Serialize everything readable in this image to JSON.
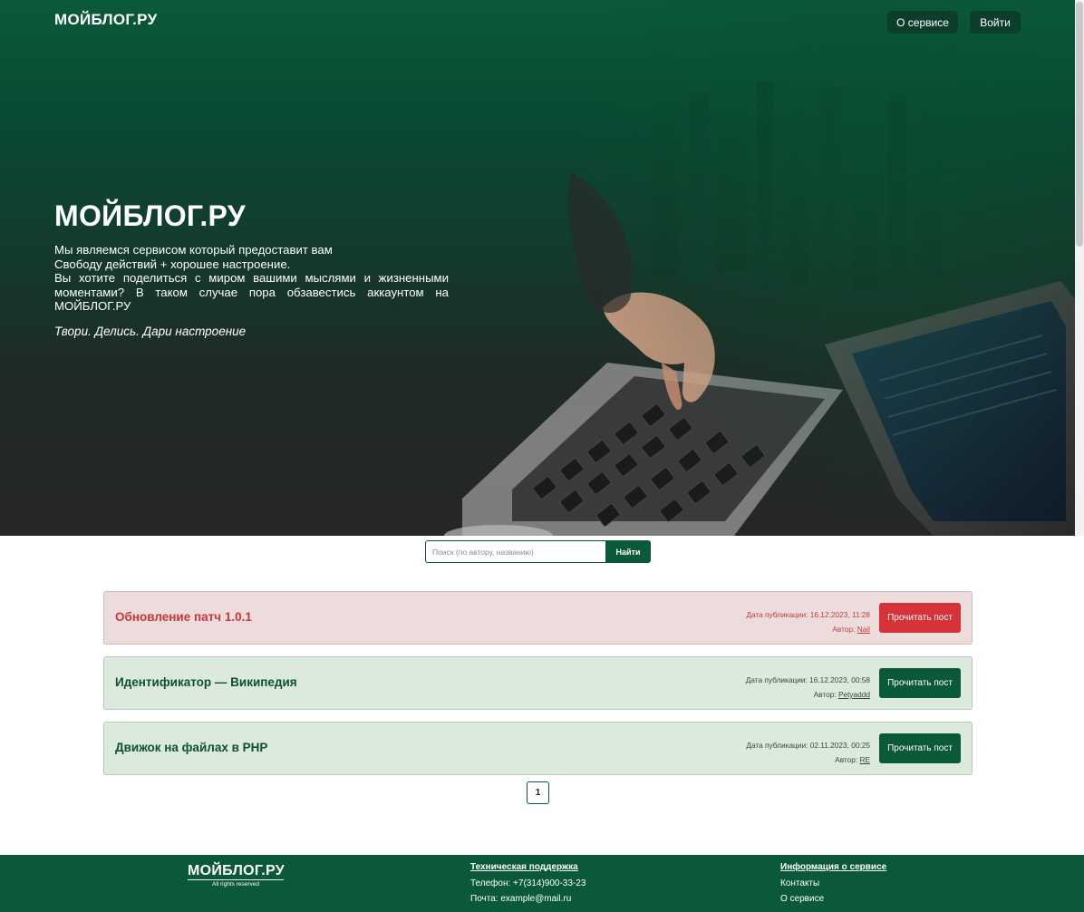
{
  "brand": {
    "name": "МОЙБЛОГ.РУ"
  },
  "nav": {
    "about_label": "О сервисе",
    "login_label": "Войти"
  },
  "hero": {
    "title": "МОЙБЛОГ.РУ",
    "line1": "Мы являемся сервисом который предоставит вам",
    "line2": "Свободу действий + хорошее настроение.",
    "line3": "Вы хотите поделиться с миром вашими мыслями и жизненными моментами? В таком случае пора обзавестись аккаунтом на МОЙБЛОГ.РУ",
    "slogan": "Твори. Делись. Дари настроение"
  },
  "search": {
    "placeholder": "Поиск (по автору, названию)",
    "button_label": "Найти"
  },
  "posts": [
    {
      "title": "Обновление патч 1.0.1",
      "date_label": "Дата публикации:",
      "date": "16.12.2023, 11:28",
      "author_label": "Автор:",
      "author": "Nail",
      "button_label": "Прочитать пост",
      "style": "red"
    },
    {
      "title": "Идентификатор — Википедия",
      "date_label": "Дата публикации:",
      "date": "16.12.2023, 00:58",
      "author_label": "Автор:",
      "author": "Petyaddd",
      "button_label": "Прочитать пост",
      "style": "green"
    },
    {
      "title": "Движок на файлах в PHP",
      "date_label": "Дата публикации:",
      "date": "02.11.2023, 00:25",
      "author_label": "Автор:",
      "author": "RE",
      "button_label": "Прочитать пост",
      "style": "green"
    }
  ],
  "pagination": {
    "current": "1"
  },
  "footer": {
    "logo": "МОЙБЛОГ.РУ",
    "rights": "All rights reserved",
    "support": {
      "heading": "Техническая поддержка",
      "phone": "Телефон: +7(314)900-33-23",
      "email": "Почта: example@mail.ru"
    },
    "info": {
      "heading": "Информация о сервисе",
      "contacts": "Контакты",
      "about": "О сервисе"
    }
  },
  "colors": {
    "brand_green": "#0a5a3a",
    "accent_red": "#d6323a",
    "post_red_bg": "#ecdcdc",
    "post_green_bg": "#dce9dd"
  }
}
